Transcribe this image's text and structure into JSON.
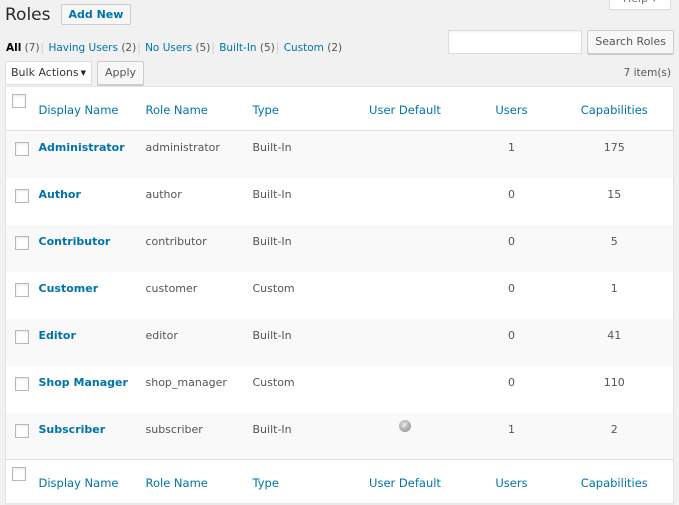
{
  "help_tab": {
    "label": "Help ▾"
  },
  "header": {
    "title": "Roles",
    "add_new_label": "Add New"
  },
  "filters": [
    {
      "label": "All",
      "count": "(7)",
      "current": true
    },
    {
      "label": "Having Users",
      "count": "(2)"
    },
    {
      "label": "No Users",
      "count": "(5)"
    },
    {
      "label": "Built-In",
      "count": "(5)"
    },
    {
      "label": "Custom",
      "count": "(2)"
    }
  ],
  "search": {
    "value": "",
    "placeholder": "",
    "button_label": "Search Roles"
  },
  "bulk": {
    "selected": "Bulk Actions",
    "apply_label": "Apply"
  },
  "items_count": "7 item(s)",
  "columns": [
    "Display Name",
    "Role Name",
    "Type",
    "User Default",
    "Users",
    "Capabilities"
  ],
  "rows": [
    {
      "display_name": "Administrator",
      "role_name": "administrator",
      "type": "Built-In",
      "user_default": false,
      "users": "1",
      "capabilities": "175"
    },
    {
      "display_name": "Author",
      "role_name": "author",
      "type": "Built-In",
      "user_default": false,
      "users": "0",
      "capabilities": "15"
    },
    {
      "display_name": "Contributor",
      "role_name": "contributor",
      "type": "Built-In",
      "user_default": false,
      "users": "0",
      "capabilities": "5"
    },
    {
      "display_name": "Customer",
      "role_name": "customer",
      "type": "Custom",
      "user_default": false,
      "users": "0",
      "capabilities": "1"
    },
    {
      "display_name": "Editor",
      "role_name": "editor",
      "type": "Built-In",
      "user_default": false,
      "users": "0",
      "capabilities": "41"
    },
    {
      "display_name": "Shop Manager",
      "role_name": "shop_manager",
      "type": "Custom",
      "user_default": false,
      "users": "0",
      "capabilities": "110"
    },
    {
      "display_name": "Subscriber",
      "role_name": "subscriber",
      "type": "Built-In",
      "user_default": true,
      "users": "1",
      "capabilities": "2"
    }
  ],
  "icons": {
    "default_marker": "check-circle-icon",
    "select_caret": "caret-down-icon"
  },
  "colors": {
    "link": "#0073aa",
    "background": "#f1f1f1",
    "row_alt": "#f9f9f9"
  }
}
